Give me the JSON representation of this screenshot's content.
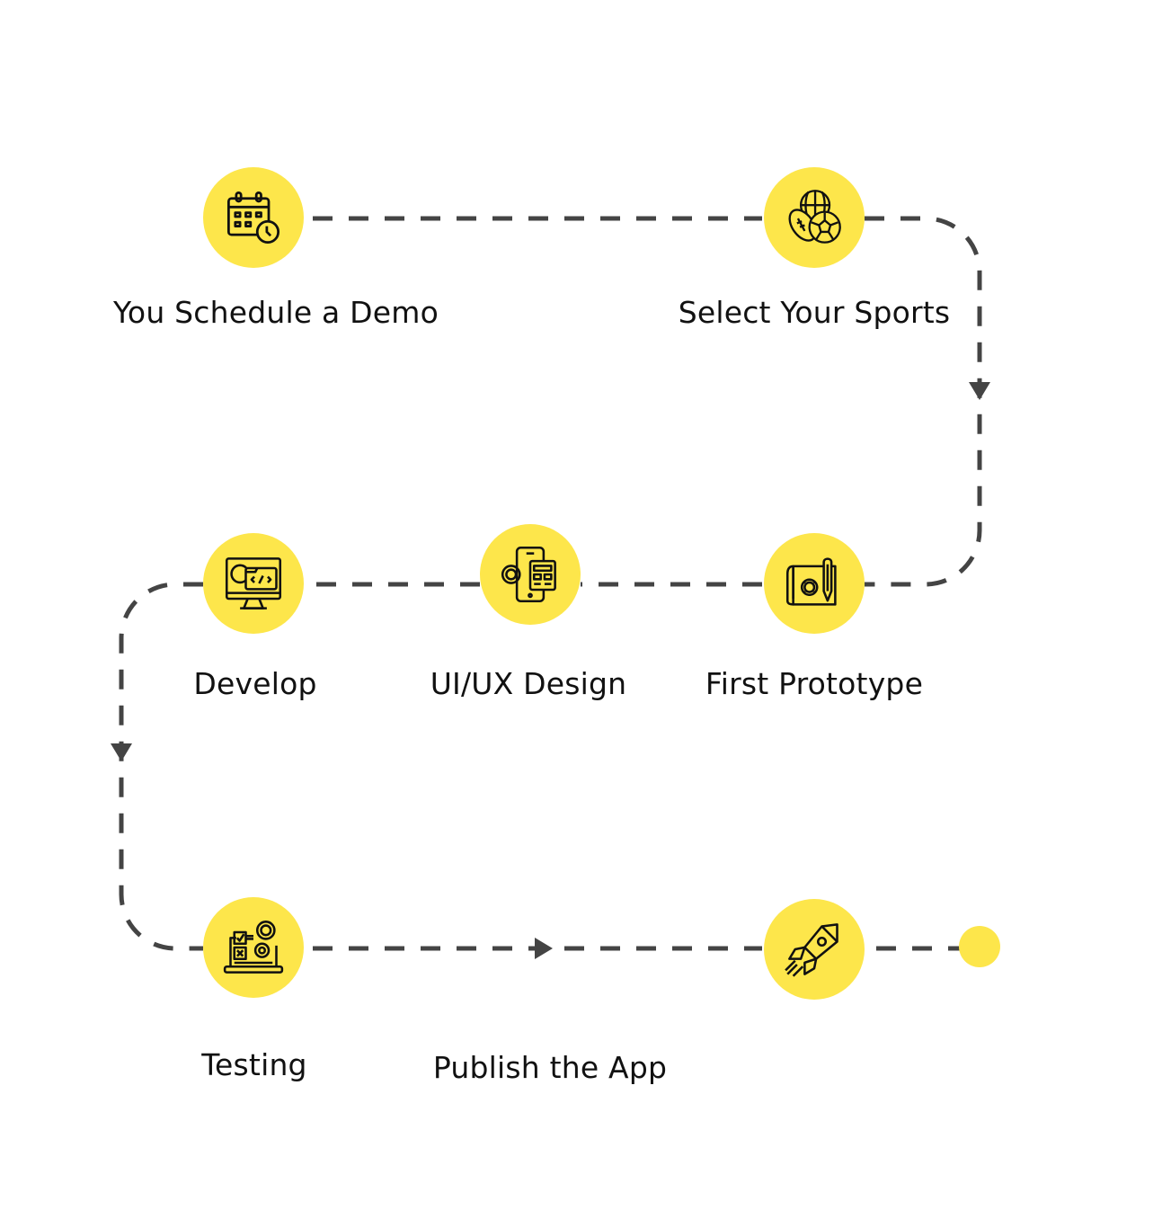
{
  "colors": {
    "accent": "#fde64b",
    "connector": "#444444",
    "icon_stroke": "#111111",
    "text": "#111111"
  },
  "steps": [
    {
      "order": 1,
      "label": "You Schedule a Demo",
      "icon": "calendar-clock-icon"
    },
    {
      "order": 2,
      "label": "Select Your Sports",
      "icon": "sports-balls-icon"
    },
    {
      "order": 3,
      "label": "First Prototype",
      "icon": "blueprint-pencil-icon"
    },
    {
      "order": 4,
      "label": "UI/UX Design",
      "icon": "mobile-design-gear-icon"
    },
    {
      "order": 5,
      "label": "Develop",
      "icon": "monitor-code-icon"
    },
    {
      "order": 6,
      "label": "Testing",
      "icon": "laptop-checklist-gears-icon"
    },
    {
      "order": 7,
      "label": "Publish the App",
      "icon": "rocket-icon"
    }
  ],
  "end_marker": "finish-dot"
}
